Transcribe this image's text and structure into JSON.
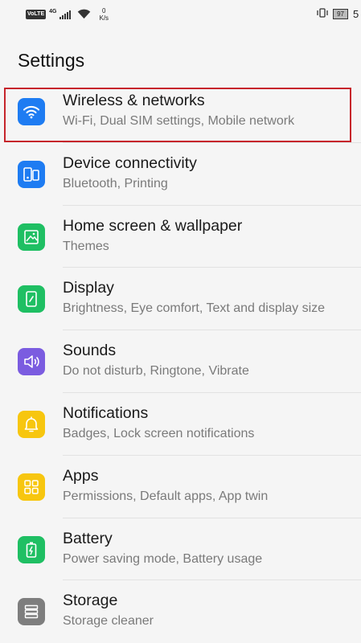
{
  "status_bar": {
    "volte": "VoLTE",
    "network_type": "4G",
    "speed_value": "0",
    "speed_unit": "K/s",
    "battery": "97",
    "time": "5"
  },
  "page": {
    "title": "Settings"
  },
  "items": [
    {
      "title": "Wireless & networks",
      "subtitle": "Wi-Fi, Dual SIM settings, Mobile network",
      "icon": "wifi-icon",
      "color": "#1e7cf2"
    },
    {
      "title": "Device connectivity",
      "subtitle": "Bluetooth, Printing",
      "icon": "device-connectivity-icon",
      "color": "#1e7cf2"
    },
    {
      "title": "Home screen & wallpaper",
      "subtitle": "Themes",
      "icon": "wallpaper-icon",
      "color": "#1fbf63"
    },
    {
      "title": "Display",
      "subtitle": "Brightness, Eye comfort, Text and display size",
      "icon": "display-icon",
      "color": "#1fbf63"
    },
    {
      "title": "Sounds",
      "subtitle": "Do not disturb, Ringtone, Vibrate",
      "icon": "speaker-icon",
      "color": "#7b5ce0"
    },
    {
      "title": "Notifications",
      "subtitle": "Badges, Lock screen notifications",
      "icon": "bell-icon",
      "color": "#f7c60f"
    },
    {
      "title": "Apps",
      "subtitle": "Permissions, Default apps, App twin",
      "icon": "apps-grid-icon",
      "color": "#f7c60f"
    },
    {
      "title": "Battery",
      "subtitle": "Power saving mode, Battery usage",
      "icon": "battery-icon",
      "color": "#1fbf63"
    },
    {
      "title": "Storage",
      "subtitle": "Storage cleaner",
      "icon": "storage-icon",
      "color": "#7e7e7e"
    }
  ]
}
